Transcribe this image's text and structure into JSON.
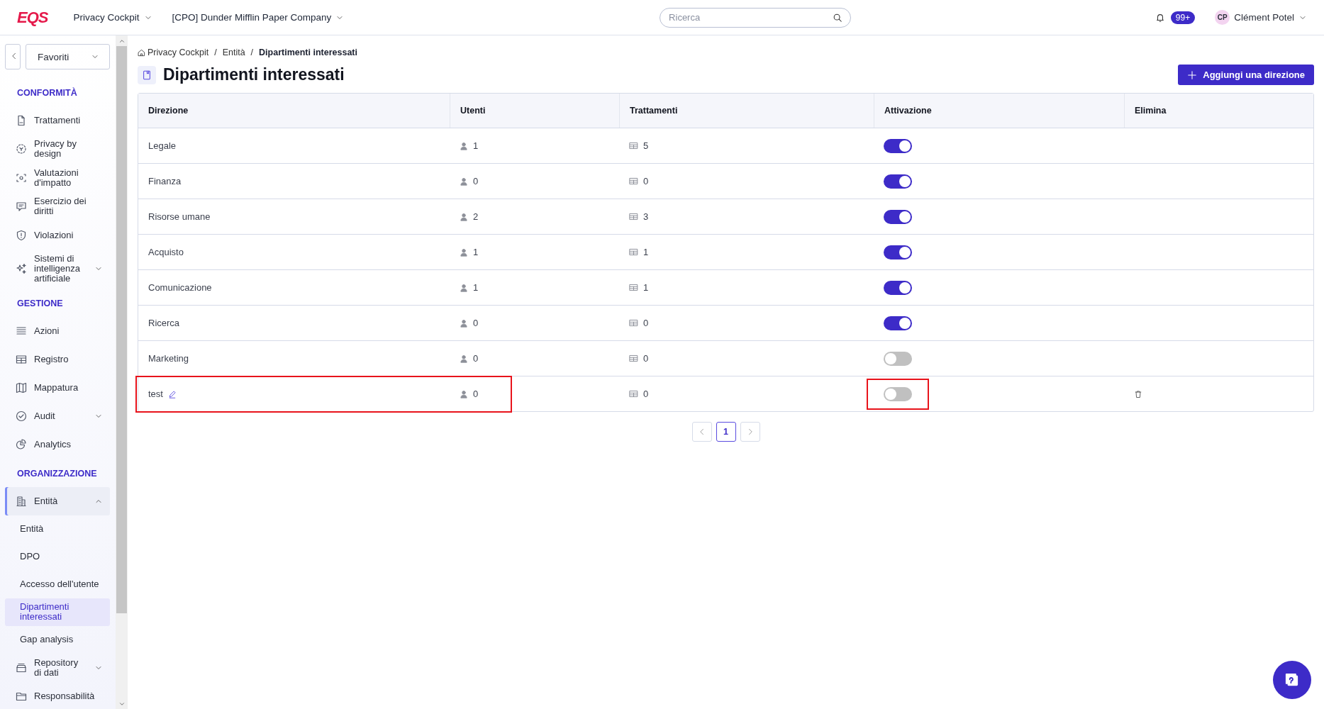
{
  "topbar": {
    "logo": "EQS",
    "nav": [
      {
        "label": "Privacy Cockpit"
      },
      {
        "label": "[CPO] Dunder Mifflin Paper Company"
      }
    ],
    "search": {
      "placeholder": "Ricerca"
    },
    "notifications": "99+",
    "user": {
      "initials": "CP",
      "name": "Clément Potel"
    }
  },
  "sidebar": {
    "favorites": "Favoriti",
    "sections": [
      {
        "title": "CONFORMITÀ",
        "items": [
          {
            "label": "Trattamenti",
            "selected": false
          },
          {
            "label": "Privacy by design",
            "selected": false
          },
          {
            "label": "Valutazioni d'impatto",
            "selected": false
          },
          {
            "label": "Esercizio dei diritti",
            "selected": false
          },
          {
            "label": "Violazioni",
            "selected": false
          },
          {
            "label": "Sistemi di intelligenza artificiale",
            "selected": false,
            "expanded": false
          }
        ]
      },
      {
        "title": "GESTIONE",
        "items": [
          {
            "label": "Azioni",
            "selected": false
          },
          {
            "label": "Registro",
            "selected": false
          },
          {
            "label": "Mappatura",
            "selected": false
          },
          {
            "label": "Audit",
            "selected": false,
            "expanded": false
          },
          {
            "label": "Analytics",
            "selected": false
          }
        ]
      },
      {
        "title": "ORGANIZZAZIONE",
        "items": [
          {
            "label": "Entità",
            "selected": true,
            "expanded": true,
            "children": [
              {
                "label": "Entità",
                "selected": false
              },
              {
                "label": "DPO",
                "selected": false
              },
              {
                "label": "Accesso dell'utente",
                "selected": false
              },
              {
                "label": "Dipartimenti interessati",
                "selected": true
              },
              {
                "label": "Gap analysis",
                "selected": false
              }
            ]
          },
          {
            "label": "Repository di dati",
            "selected": false,
            "expanded": false
          },
          {
            "label": "Responsabilità",
            "selected": false
          }
        ]
      }
    ]
  },
  "breadcrumb": {
    "separator": "/",
    "items": [
      "Privacy Cockpit",
      "Entità",
      "Dipartimenti interessati"
    ]
  },
  "page_title": "Dipartimenti interessati",
  "add_button": "Aggiungi una direzione",
  "table": {
    "columns": [
      "Direzione",
      "Utenti",
      "Trattamenti",
      "Attivazione",
      "Elimina"
    ],
    "rows": [
      {
        "name": "Legale",
        "users": "1",
        "treatments": "5",
        "active": true,
        "editable": false,
        "deletable": false,
        "outlined": false
      },
      {
        "name": "Finanza",
        "users": "0",
        "treatments": "0",
        "active": true,
        "editable": false,
        "deletable": false,
        "outlined": false
      },
      {
        "name": "Risorse umane",
        "users": "2",
        "treatments": "3",
        "active": true,
        "editable": false,
        "deletable": false,
        "outlined": false
      },
      {
        "name": "Acquisto",
        "users": "1",
        "treatments": "1",
        "active": true,
        "editable": false,
        "deletable": false,
        "outlined": false
      },
      {
        "name": "Comunicazione",
        "users": "1",
        "treatments": "1",
        "active": true,
        "editable": false,
        "deletable": false,
        "outlined": false
      },
      {
        "name": "Ricerca",
        "users": "0",
        "treatments": "0",
        "active": true,
        "editable": false,
        "deletable": false,
        "outlined": false
      },
      {
        "name": "Marketing",
        "users": "0",
        "treatments": "0",
        "active": false,
        "editable": false,
        "deletable": false,
        "outlined": false
      },
      {
        "name": "test",
        "users": "0",
        "treatments": "0",
        "active": false,
        "editable": true,
        "deletable": true,
        "outlined": true
      }
    ]
  },
  "pagination": {
    "pages": [
      {
        "label": "1",
        "selected": true
      }
    ]
  }
}
